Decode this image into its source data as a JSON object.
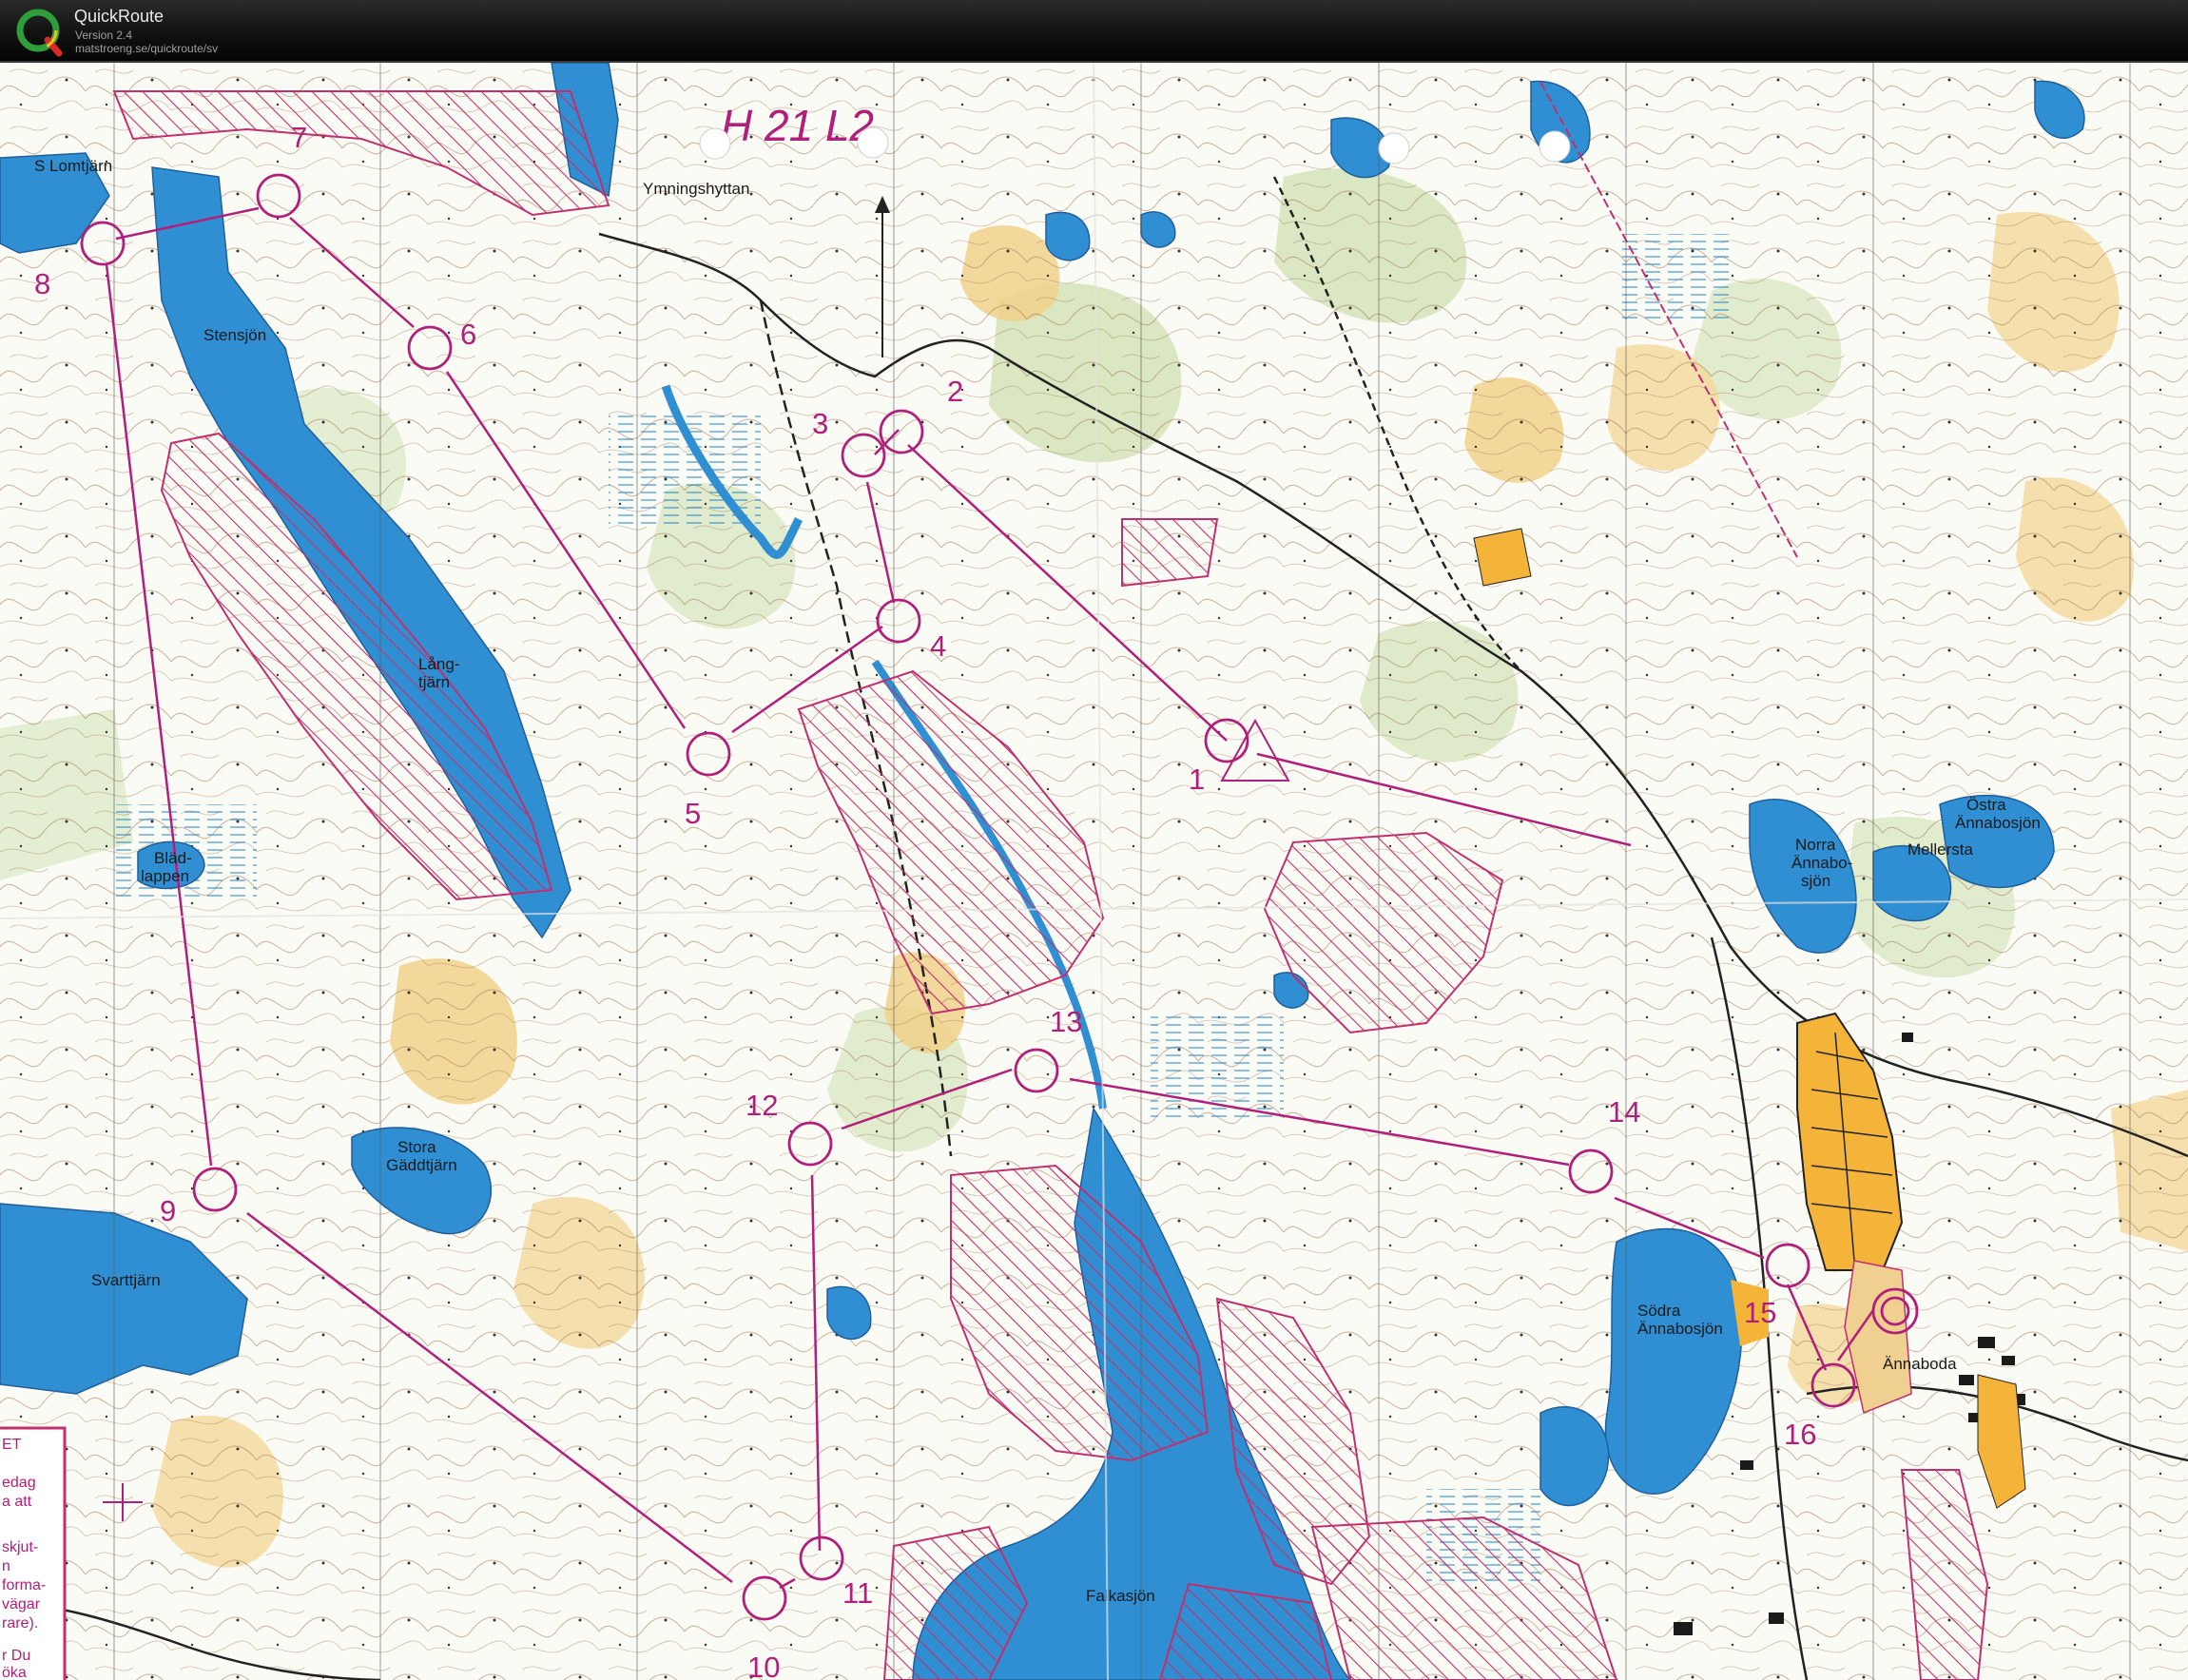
{
  "app": {
    "name": "QuickRoute",
    "version": "Version 2.4",
    "url": "matstroeng.se/quickroute/sv",
    "logo_letter": "Q"
  },
  "map": {
    "handwritten_note": "H 21 L2",
    "place_labels": [
      {
        "id": "s-lomtjarn",
        "lines": [
          "S Lomtjärn"
        ]
      },
      {
        "id": "stensjon",
        "lines": [
          "Stensjön"
        ]
      },
      {
        "id": "ymningshyttan",
        "lines": [
          "Ymningshyttan"
        ]
      },
      {
        "id": "langtjarn",
        "lines": [
          "Lång-",
          "tjärn"
        ]
      },
      {
        "id": "bladlappen",
        "lines": [
          "Bläd-",
          "lappen"
        ]
      },
      {
        "id": "stora-gaddtjarn",
        "lines": [
          "Stora",
          "Gäddtjärn"
        ]
      },
      {
        "id": "svarttjarn",
        "lines": [
          "Svarttjärn"
        ]
      },
      {
        "id": "norra-annabosjon",
        "lines": [
          "Norra",
          "Ännabo-",
          "sjön"
        ]
      },
      {
        "id": "mellersta",
        "lines": [
          "Mellersta"
        ]
      },
      {
        "id": "ostra-annabosjon",
        "lines": [
          "Östra",
          "Ännabosjön"
        ]
      },
      {
        "id": "sodra-annabosjon",
        "lines": [
          "Södra",
          "Ännabosjön"
        ]
      },
      {
        "id": "annaboda",
        "lines": [
          "Ännaboda"
        ]
      },
      {
        "id": "falkasjon",
        "lines": [
          "Falkasjön"
        ]
      }
    ],
    "controls": [
      "1",
      "2",
      "3",
      "4",
      "5",
      "6",
      "7",
      "8",
      "9",
      "10",
      "11",
      "12",
      "13",
      "14",
      "15",
      "16"
    ],
    "info_box_lines": [
      "ET",
      "edag",
      "a att",
      "skjut-",
      "n",
      "forma-",
      "vägar",
      "rare).",
      "r Du",
      "öka"
    ],
    "colors": {
      "course": "#b0207a",
      "water": "#2f8fd2",
      "open_land": "#f1cf86",
      "vegetation": "#cfe0b0",
      "contour": "#a0724a",
      "forbidden_hatch": "#c0306e"
    }
  }
}
